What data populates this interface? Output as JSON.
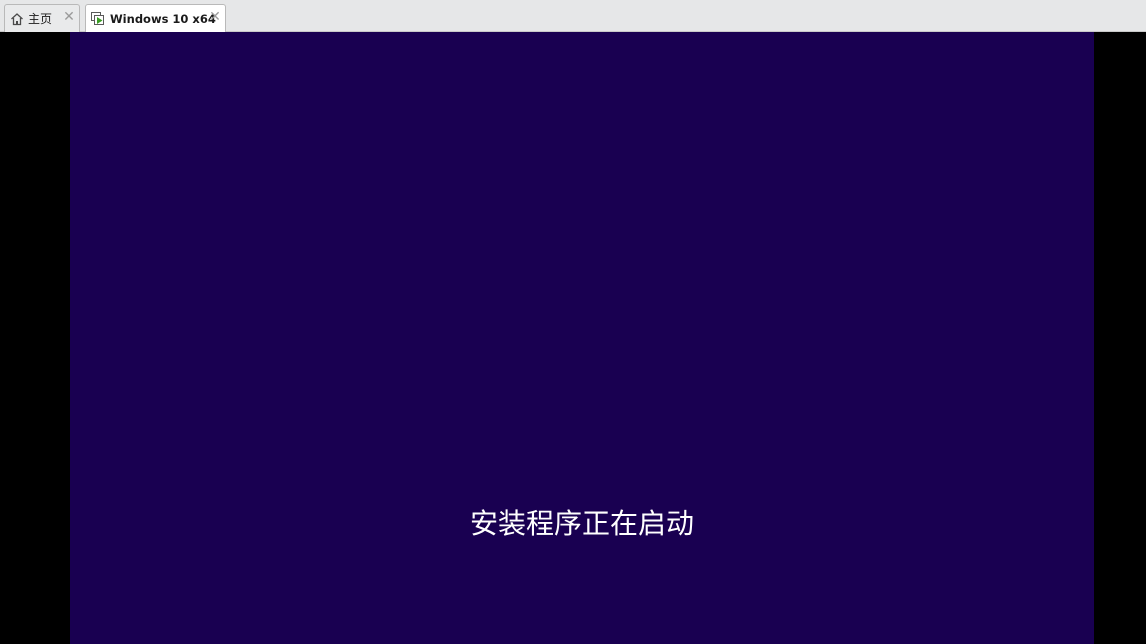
{
  "tabs": [
    {
      "label": "主页",
      "icon": "home-icon",
      "active": false
    },
    {
      "label": "Windows 10 x64",
      "icon": "vm-running-icon",
      "active": true
    }
  ],
  "tab_close_glyph": "✕",
  "vm_screen": {
    "message": "安装程序正在启动",
    "background_color": "#190051",
    "text_color": "#ffffff"
  },
  "colors": {
    "tabbar_bg": "#e6e7e8",
    "letterbox": "#000000",
    "vm_icon_green": "#3a9d23"
  }
}
